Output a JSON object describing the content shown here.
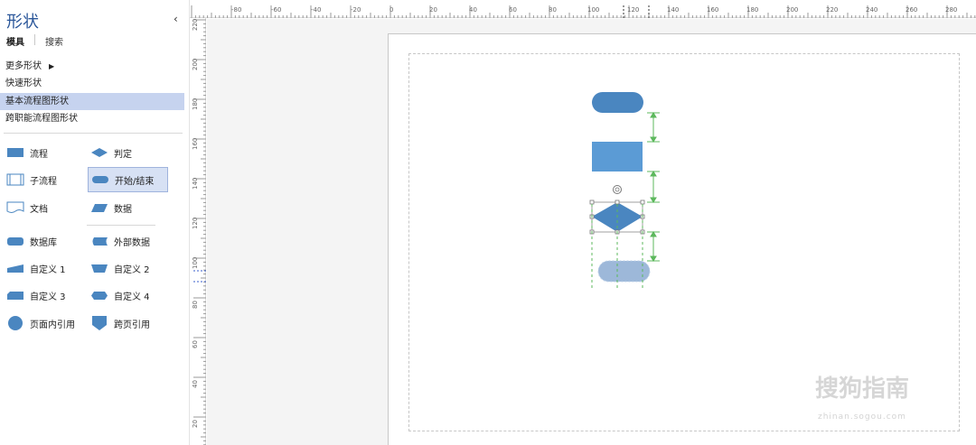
{
  "panel": {
    "title": "形状",
    "collapse_glyph": "‹",
    "tabs": [
      {
        "label": "模具",
        "active": true
      },
      {
        "label": "搜索",
        "active": false
      }
    ],
    "menu": [
      {
        "label": "更多形状",
        "has_submenu": true,
        "selected": false
      },
      {
        "label": "快速形状",
        "selected": false
      },
      {
        "label": "基本流程图形状",
        "selected": true
      },
      {
        "label": "跨职能流程图形状",
        "selected": false
      }
    ],
    "shapes": [
      {
        "label": "流程",
        "icon": "process-icon"
      },
      {
        "label": "判定",
        "icon": "decision-icon"
      },
      {
        "label": "子流程",
        "icon": "subprocess-icon"
      },
      {
        "label": "开始/结束",
        "icon": "terminator-icon",
        "selected": true
      },
      {
        "label": "文档",
        "icon": "document-icon"
      },
      {
        "label": "数据",
        "icon": "data-icon"
      },
      {
        "label": "数据库",
        "icon": "database-icon"
      },
      {
        "label": "外部数据",
        "icon": "external-data-icon"
      },
      {
        "label": "自定义 1",
        "icon": "custom1-icon"
      },
      {
        "label": "自定义 2",
        "icon": "custom2-icon"
      },
      {
        "label": "自定义 3",
        "icon": "custom3-icon"
      },
      {
        "label": "自定义 4",
        "icon": "custom4-icon"
      },
      {
        "label": "页面内引用",
        "icon": "on-page-reference-icon"
      },
      {
        "label": "跨页引用",
        "icon": "off-page-reference-icon"
      }
    ]
  },
  "ruler": {
    "horizontal": [
      "-80",
      "-60",
      "-40",
      "-20",
      "0",
      "20",
      "40",
      "60",
      "80",
      "100",
      "120",
      "140",
      "160",
      "180",
      "200",
      "220",
      "240",
      "260",
      "280"
    ],
    "vertical": [
      "220",
      "200",
      "180",
      "160",
      "140",
      "120",
      "100",
      "80",
      "60",
      "40",
      "20"
    ]
  },
  "colors": {
    "accent": "#2b579a",
    "shape_fill": "#4a86c0",
    "shape_fill_light": "#5b9bd5",
    "ghost_fill": "#9db8d9",
    "guide_green": "#5cb85c",
    "selected_menu": "#c6d3ef"
  },
  "watermark": {
    "text": "搜狗指南",
    "url": "zhinan.sogou.com"
  }
}
